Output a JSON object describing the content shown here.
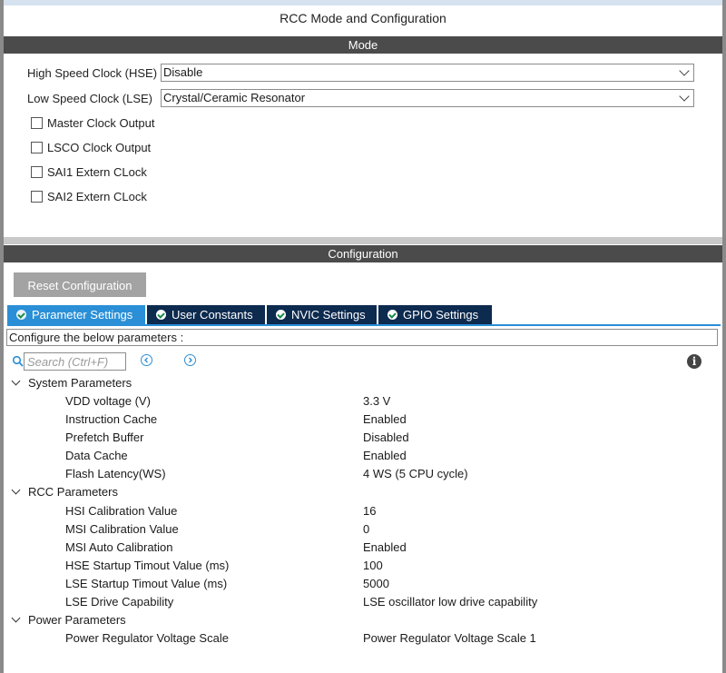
{
  "window": {
    "title": "RCC Mode and Configuration"
  },
  "mode": {
    "header": "Mode",
    "hse": {
      "label": "High Speed Clock (HSE)",
      "value": "Disable"
    },
    "lse": {
      "label": "Low Speed Clock (LSE)",
      "value": "Crystal/Ceramic Resonator"
    },
    "checkboxes": [
      {
        "label": "Master Clock Output",
        "checked": false
      },
      {
        "label": "LSCO Clock Output",
        "checked": false
      },
      {
        "label": "SAI1 Extern CLock",
        "checked": false
      },
      {
        "label": "SAI2 Extern CLock",
        "checked": false
      }
    ]
  },
  "configuration": {
    "header": "Configuration",
    "reset_label": "Reset Configuration",
    "tabs": [
      {
        "label": "Parameter Settings",
        "active": true
      },
      {
        "label": "User Constants",
        "active": false
      },
      {
        "label": "NVIC Settings",
        "active": false
      },
      {
        "label": "GPIO Settings",
        "active": false
      }
    ],
    "hint": "Configure the below parameters :",
    "search_placeholder": "Search (Ctrl+F)",
    "groups": [
      {
        "name": "System Parameters",
        "params": [
          {
            "name": "VDD voltage (V)",
            "value": "3.3 V"
          },
          {
            "name": "Instruction Cache",
            "value": "Enabled"
          },
          {
            "name": "Prefetch Buffer",
            "value": "Disabled"
          },
          {
            "name": "Data Cache",
            "value": "Enabled"
          },
          {
            "name": "Flash Latency(WS)",
            "value": "4 WS (5 CPU cycle)"
          }
        ]
      },
      {
        "name": "RCC Parameters",
        "params": [
          {
            "name": "HSI Calibration Value",
            "value": "16"
          },
          {
            "name": "MSI Calibration Value",
            "value": "0"
          },
          {
            "name": "MSI Auto Calibration",
            "value": "Enabled"
          },
          {
            "name": "HSE Startup Timout Value (ms)",
            "value": "100"
          },
          {
            "name": "LSE Startup Timout Value (ms)",
            "value": "5000"
          },
          {
            "name": "LSE Drive Capability",
            "value": "LSE oscillator low drive capability"
          }
        ]
      },
      {
        "name": "Power Parameters",
        "params": [
          {
            "name": "Power Regulator Voltage Scale",
            "value": "Power Regulator Voltage Scale 1"
          }
        ]
      }
    ]
  },
  "colors": {
    "header_bar": "#4b4b4b",
    "tab_active": "#2a8fd6",
    "tab_inactive": "#0d2a4f",
    "reset_button": "#a3a3a3"
  },
  "icons": {
    "search": "search-icon",
    "prev": "arrow-left-circle-icon",
    "next": "arrow-right-circle-icon",
    "info": "info-icon",
    "tab_check": "check-circle-icon",
    "dropdown": "chevron-down-icon",
    "group_toggle": "chevron-down-icon"
  }
}
